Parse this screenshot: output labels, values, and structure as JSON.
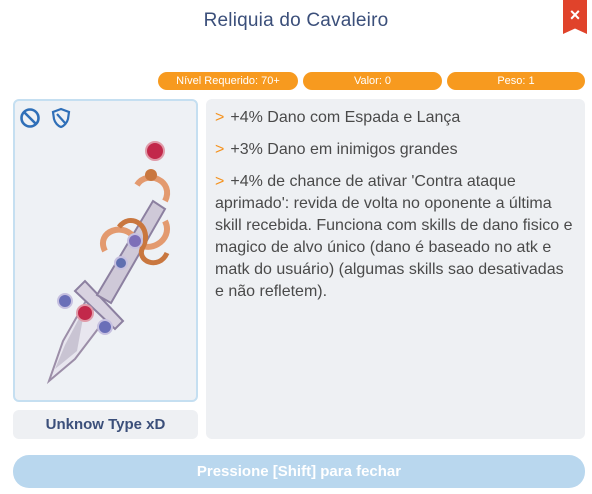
{
  "window": {
    "title": "Reliquia do Cavaleiro",
    "close_label": "×"
  },
  "stats": {
    "level": "Nível Requerido: 70+",
    "value": "Valor: 0",
    "weight": "Peso: 1"
  },
  "item": {
    "type_label": "Unknow Type xD",
    "badges": [
      "block-icon",
      "shield-icon"
    ]
  },
  "description": {
    "lines": [
      {
        "marker": ">",
        "text": "+4% Dano com Espada e Lança"
      },
      {
        "marker": ">",
        "text": "+3% Dano em inimigos grandes"
      },
      {
        "marker": ">",
        "text": "+4% de chance de ativar 'Contra ataque aprimado': revida de volta no oponente a última skill recebida. Funciona com skills de dano fisico e magico de alvo único (dano é baseado no atk e matk do usuário) (algumas skills sao desativadas e não refletem)."
      }
    ]
  },
  "footer": {
    "close_hint": "Pressione [Shift] para fechar"
  },
  "colors": {
    "accent": "#f79a1f",
    "close": "#e0432b",
    "title": "#3b4f7a",
    "footer_bar": "#b9d7ee"
  }
}
